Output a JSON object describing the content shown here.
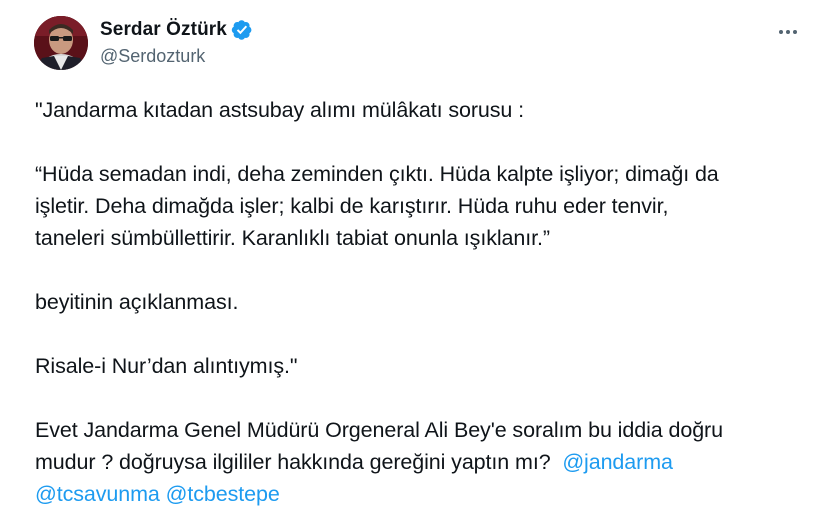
{
  "author": {
    "display_name": "Serdar Öztürk",
    "handle": "@Serdozturk",
    "verified": true,
    "verified_color": "#1d9bf0"
  },
  "tweet": {
    "line1": "\"Jandarma kıtadan astsubay alımı mülâkatı sorusu :",
    "quote_line1": "“Hüda semadan indi, deha zeminden çıktı. Hüda kalpte işliyor; dimağı da",
    "quote_line2": "işletir. Deha dimağda işler; kalbi de karıştırır. Hüda ruhu eder tenvir,",
    "quote_line3": "taneleri sümbüllettirir. Karanlıklı tabiat onunla ışıklanır.”",
    "explain_line": "beyitinin açıklanması.",
    "source_line": "Risale-i Nur’dan alıntıymış.\"",
    "question_line1": "Evet Jandarma Genel Müdürü Orgeneral Ali Bey'e soralım bu iddia doğru",
    "question_line2": "mudur ? doğruysa ilgililer hakkında gereğini yaptın mı?",
    "mentions": [
      "@jandarma",
      "@tcsavunma",
      "@tcbestepe"
    ]
  },
  "colors": {
    "link": "#1d9bf0",
    "text": "#0f1419",
    "secondary": "#536471"
  },
  "icons": {
    "verified": "verified-badge-icon",
    "more": "more-options-icon"
  }
}
